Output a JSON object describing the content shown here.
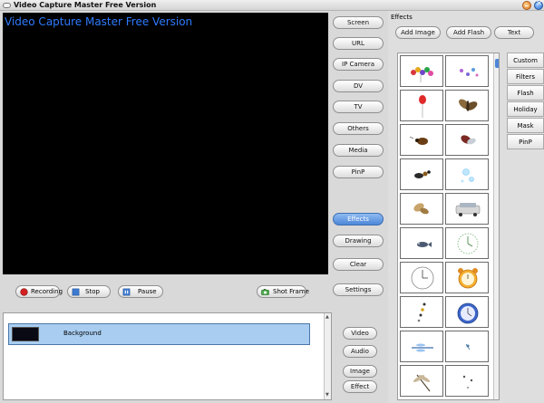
{
  "window": {
    "title": "Video Capture Master Free Version"
  },
  "preview": {
    "overlay_title": "Video Capture Master Free Version"
  },
  "sources": [
    "Screen",
    "URL",
    "IP Camera",
    "DV",
    "TV",
    "Others",
    "Media",
    "PinP"
  ],
  "side_actions": {
    "effects": "Effects",
    "drawing": "Drawing",
    "clear": "Clear",
    "settings": "Settings"
  },
  "controls": {
    "recording": "Recording",
    "stop": "Stop",
    "pause": "Pause",
    "shot_frame": "Shot Frame"
  },
  "tracks": [
    {
      "label": "Background"
    }
  ],
  "add_buttons": {
    "video": "Video",
    "audio": "Audio",
    "image": "Image",
    "effect": "Effect"
  },
  "effects": {
    "header": "Effects",
    "add_image": "Add Image",
    "add_flash": "Add Flash",
    "text": "Text",
    "categories": [
      "Custom",
      "Filters",
      "Flash",
      "Holiday",
      "Mask",
      "PinP"
    ],
    "thumbnails": [
      "balloons",
      "butterflies-group",
      "red-balloon",
      "moth",
      "beetle",
      "bug",
      "ant",
      "bubbles",
      "butterfly",
      "car",
      "fish",
      "clock-green",
      "wall-clock",
      "alarm-clock",
      "petals",
      "blue-clock",
      "dragonfly-blue",
      "insect-small",
      "dragonfly",
      "insects"
    ]
  },
  "colors": {
    "accent": "#4d87d8",
    "preview_title": "#2f7bff",
    "track_selected": "#a8cdf0"
  }
}
